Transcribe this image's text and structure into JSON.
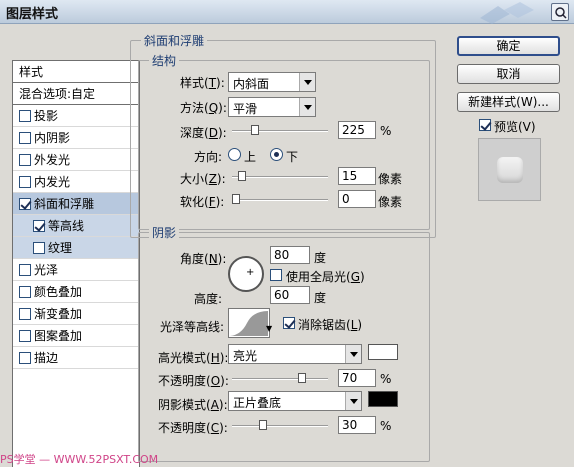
{
  "window": {
    "title": "图层样式"
  },
  "sidebar": {
    "header": "样式",
    "blend_options": "混合选项:自定",
    "items": [
      {
        "label": "投影",
        "checked": false
      },
      {
        "label": "内阴影",
        "checked": false
      },
      {
        "label": "外发光",
        "checked": false
      },
      {
        "label": "内发光",
        "checked": false
      },
      {
        "label": "斜面和浮雕",
        "checked": true
      },
      {
        "label": "等高线",
        "checked": true
      },
      {
        "label": "纹理",
        "checked": false
      },
      {
        "label": "光泽",
        "checked": false
      },
      {
        "label": "颜色叠加",
        "checked": false
      },
      {
        "label": "渐变叠加",
        "checked": false
      },
      {
        "label": "图案叠加",
        "checked": false
      },
      {
        "label": "描边",
        "checked": false
      }
    ]
  },
  "bevel": {
    "section_title": "斜面和浮雕",
    "structure_title": "结构",
    "style_label": "样式(",
    "style_key": "T",
    "style_value": "内斜面",
    "technique_label": "方法(",
    "technique_key": "Q",
    "technique_value": "平滑",
    "depth_label": "深度(",
    "depth_key": "D",
    "depth_value": "225",
    "percent": "%",
    "direction_label": "方向:",
    "dir_up": "上",
    "dir_down": "下",
    "size_label": "大小(",
    "size_key": "Z",
    "size_value": "15",
    "soften_label": "软化(",
    "soften_key": "F",
    "soften_value": "0",
    "pixels": "像素",
    "close": "):"
  },
  "shading": {
    "title": "阴影",
    "angle_label": "角度(",
    "angle_key": "N",
    "angle_value": "80",
    "degree": "度",
    "global_light": "使用全局光(",
    "global_key": "G",
    "altitude_label": "高度:",
    "altitude_value": "60",
    "gloss_label": "光泽等高线:",
    "antialias": "消除锯齿(",
    "antialias_key": "L",
    "highlight_label": "高光模式(",
    "highlight_key": "H",
    "highlight_value": "亮光",
    "highlight_color": "#ffffff",
    "opacity_label": "不透明度(",
    "opacity1_key": "O",
    "opacity1_value": "70",
    "shadow_label": "阴影模式(",
    "shadow_key": "A",
    "shadow_value": "正片叠底",
    "shadow_color": "#000000",
    "opacity2_key": "C",
    "opacity2_value": "30"
  },
  "buttons": {
    "ok": "确定",
    "cancel": "取消",
    "new_style": "新建样式(W)...",
    "preview": "预览(V)"
  },
  "watermark": "PS学堂 — WWW.52PSXT.COM"
}
